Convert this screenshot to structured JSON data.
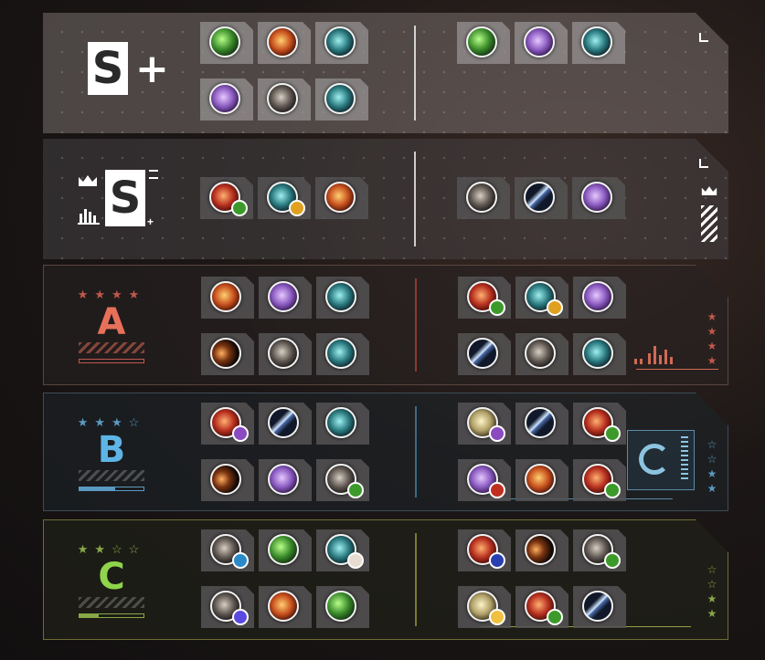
{
  "tiers": {
    "splus": {
      "letter": "S",
      "suffix": "+"
    },
    "s": {
      "letter": "S"
    },
    "a": {
      "letter": "A",
      "stars": "★★★★"
    },
    "b": {
      "letter": "B",
      "stars": "★★★☆"
    },
    "c": {
      "letter": "C",
      "stars": "★★☆☆"
    }
  },
  "colors": {
    "a": "#e8705a",
    "b": "#5fb4e6",
    "c": "#8fd44a",
    "star_a": "#c0584a",
    "star_b": "#5a9ac0",
    "star_c": "#88a848"
  },
  "icons": {
    "green-slash": "#3a8a2a",
    "fire-feather": "#c8501e",
    "teal-bomb": "#2a7a80",
    "purple-cloud": "#8a5ac0",
    "stone-fist": "#5e5650",
    "red-burst": "#b83020",
    "glow-sword": "#4a6aa8",
    "dark-arc": "#7a3410",
    "scroll": "#b0a068",
    "sub-green": "#3c9a2a",
    "sub-orange": "#e0a020",
    "sub-purple": "#8a4ac0",
    "sub-red": "#c03020",
    "sub-blue": "#2a8ac8",
    "sub-white": "#e6dccf",
    "sub-navy": "#2a40b0",
    "sub-violet": "#5a4ae0",
    "sub-gold": "#f0c040"
  }
}
